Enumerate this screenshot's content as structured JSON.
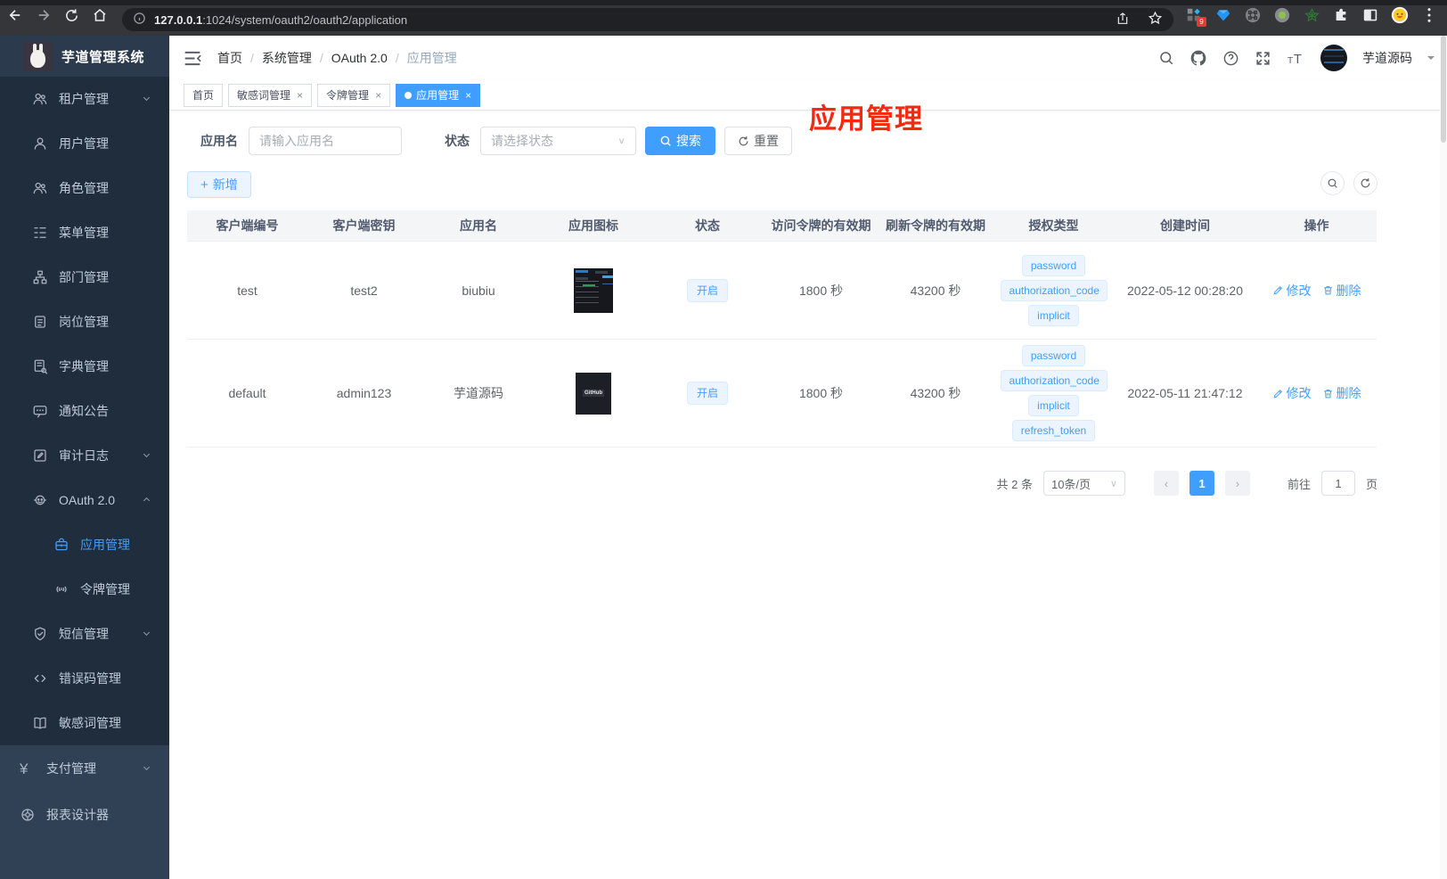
{
  "colors": {
    "accent": "#409eff",
    "sidebar_bg": "#304156",
    "submenu_bg": "#1f2d3d",
    "annotation_red": "#f5290f",
    "tag_blue_bg": "#ecf5ff"
  },
  "browser": {
    "url_host": "127.0.0.1",
    "url_path": ":1024/system/oauth2/oauth2/application",
    "extension_badge": "9",
    "pill_icons": [
      "share-icon",
      "bookmark-star-icon"
    ],
    "extension_icons": [
      "extensions-grid-icon",
      "blue-gem-icon",
      "command-circle-icon",
      "green-dot-circle-icon",
      "green-star-icon",
      "puzzle-icon",
      "split-view-icon",
      "emoji-avatar-icon",
      "overflow-menu-icon"
    ]
  },
  "app": {
    "logo_title": "芋道管理系统",
    "username": "芋道源码"
  },
  "sidebar": {
    "items": [
      {
        "icon": "users-icon",
        "label": "租户管理",
        "level": 1,
        "chevron": "down",
        "active": false
      },
      {
        "icon": "user-icon",
        "label": "用户管理",
        "level": 1,
        "chevron": "none",
        "active": false
      },
      {
        "icon": "users-icon",
        "label": "角色管理",
        "level": 1,
        "chevron": "none",
        "active": false
      },
      {
        "icon": "menu-tree-icon",
        "label": "菜单管理",
        "level": 1,
        "chevron": "none",
        "active": false
      },
      {
        "icon": "org-tree-icon",
        "label": "部门管理",
        "level": 1,
        "chevron": "none",
        "active": false
      },
      {
        "icon": "id-badge-icon",
        "label": "岗位管理",
        "level": 1,
        "chevron": "none",
        "active": false
      },
      {
        "icon": "dict-book-icon",
        "label": "字典管理",
        "level": 1,
        "chevron": "none",
        "active": false
      },
      {
        "icon": "message-icon",
        "label": "通知公告",
        "level": 1,
        "chevron": "none",
        "active": false
      },
      {
        "icon": "edit-log-icon",
        "label": "审计日志",
        "level": 1,
        "chevron": "down",
        "active": false
      },
      {
        "icon": "robot-icon",
        "label": "OAuth 2.0",
        "level": 1,
        "chevron": "up",
        "active": false
      },
      {
        "icon": "briefcase-icon",
        "label": "应用管理",
        "level": 2,
        "chevron": "none",
        "active": true
      },
      {
        "icon": "signal-icon",
        "label": "令牌管理",
        "level": 2,
        "chevron": "none",
        "active": false
      },
      {
        "icon": "shield-icon",
        "label": "短信管理",
        "level": 1,
        "chevron": "down",
        "active": false
      },
      {
        "icon": "code-icon",
        "label": "错误码管理",
        "level": 1,
        "chevron": "none",
        "active": false
      },
      {
        "icon": "open-book-icon",
        "label": "敏感词管理",
        "level": 1,
        "chevron": "none",
        "active": false
      },
      {
        "icon": "yen-icon",
        "label": "支付管理",
        "level": 0,
        "chevron": "down",
        "active": false
      },
      {
        "icon": "report-icon",
        "label": "报表设计器",
        "level": 0,
        "chevron": "none",
        "active": false
      }
    ]
  },
  "breadcrumb": {
    "items": [
      "首页",
      "系统管理",
      "OAuth 2.0"
    ],
    "current": "应用管理",
    "separator": "/"
  },
  "navbar_icons": [
    "search-icon",
    "github-icon",
    "help-icon",
    "fullscreen-icon",
    "font-size-icon"
  ],
  "tabs": [
    {
      "label": "首页",
      "closable": false,
      "active": false
    },
    {
      "label": "敏感词管理",
      "closable": true,
      "active": false
    },
    {
      "label": "令牌管理",
      "closable": true,
      "active": false
    },
    {
      "label": "应用管理",
      "closable": true,
      "active": true
    }
  ],
  "annotation": {
    "text": "应用管理"
  },
  "filter": {
    "name_label": "应用名",
    "name_placeholder": "请输入应用名",
    "status_label": "状态",
    "status_placeholder": "请选择状态",
    "search_label": "搜索",
    "reset_label": "重置"
  },
  "toolbar": {
    "add_label": "新增"
  },
  "table": {
    "columns": [
      "客户端编号",
      "客户端密钥",
      "应用名",
      "应用图标",
      "状态",
      "访问令牌的有效期",
      "刷新令牌的有效期",
      "授权类型",
      "创建时间",
      "操作"
    ],
    "rows": [
      {
        "client_id": "test",
        "client_secret": "test2",
        "app_name": "biubiu",
        "app_icon": "dashboard-screenshot-thumbnail",
        "status": "开启",
        "access_validity": "1800 秒",
        "refresh_validity": "43200 秒",
        "grant_types": [
          "password",
          "authorization_code",
          "implicit"
        ],
        "created_at": "2022-05-12 00:28:20",
        "edit_label": "修改",
        "delete_label": "删除"
      },
      {
        "client_id": "default",
        "client_secret": "admin123",
        "app_name": "芋道源码",
        "app_icon": "github-dark-thumbnail",
        "status": "开启",
        "access_validity": "1800 秒",
        "refresh_validity": "43200 秒",
        "grant_types": [
          "password",
          "authorization_code",
          "implicit",
          "refresh_token"
        ],
        "created_at": "2022-05-11 21:47:12",
        "edit_label": "修改",
        "delete_label": "删除"
      }
    ]
  },
  "pagination": {
    "total": "共 2 条",
    "page_size": "10条/页",
    "current_page": "1",
    "goto_label": "前往",
    "goto_value": "1",
    "goto_unit": "页"
  }
}
